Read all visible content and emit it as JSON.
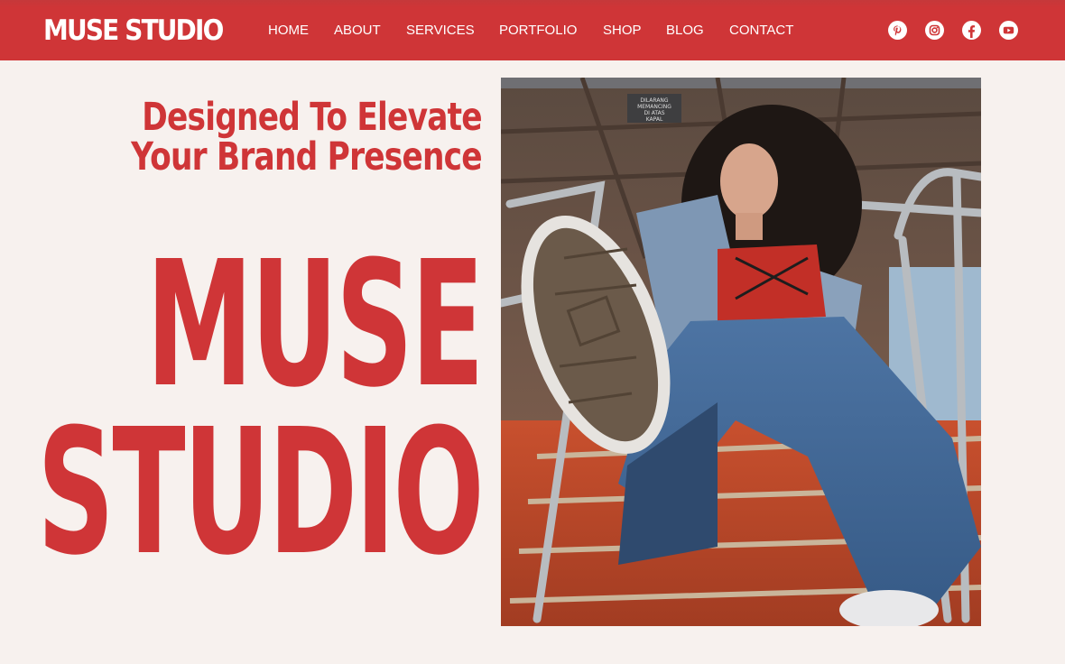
{
  "header": {
    "logo": "MUSE STUDIO",
    "nav": [
      {
        "label": "HOME"
      },
      {
        "label": "ABOUT"
      },
      {
        "label": "SERVICES"
      },
      {
        "label": "PORTFOLIO"
      },
      {
        "label": "SHOP"
      },
      {
        "label": "BLOG"
      },
      {
        "label": "CONTACT"
      }
    ],
    "social_icons": [
      "pinterest-icon",
      "instagram-icon",
      "facebook-icon",
      "youtube-icon"
    ]
  },
  "hero": {
    "tagline_line1": "Designed To Elevate",
    "tagline_line2": "Your Brand Presence",
    "title_line1": "MUSE",
    "title_line2": "STUDIO",
    "photo_sign": [
      "DILARANG",
      "MEMANCING",
      "DI ATAS",
      "KAPAL"
    ]
  },
  "colors": {
    "brand_red": "#cf3537",
    "background": "#f7f1ee",
    "text_on_red": "#ffffff"
  }
}
